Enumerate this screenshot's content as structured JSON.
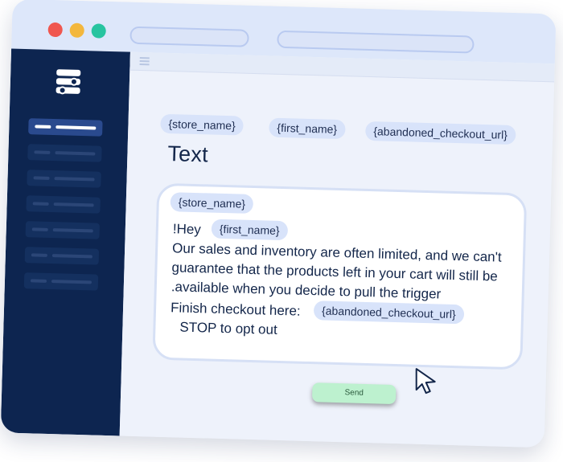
{
  "merge_tags": {
    "store_name": "{store_name}",
    "first_name": "{first_name}",
    "abandoned_checkout_url": "{abandoned_checkout_url}"
  },
  "editor": {
    "heading": "Text",
    "line_hey": "!Hey",
    "line_1": "Our sales and inventory are often limited, and we can't",
    "line_2": "guarantee that the products left in your cart will still be",
    "line_3": ".available when you decide to pull the trigger",
    "line_checkout": "Finish checkout here:",
    "line_stop": "STOP to opt out"
  },
  "send_label": "Send",
  "icons": {
    "logo": "layers-logo-icon",
    "menu": "menu-icon",
    "cursor": "mouse-cursor-icon"
  },
  "colors": {
    "sidebar": "#0d2550",
    "tag_bg": "#d8e3fa",
    "send_button": "#bdf1cf",
    "dot_red": "#f0574f",
    "dot_yellow": "#f3b73d",
    "dot_green": "#27c4a0"
  }
}
